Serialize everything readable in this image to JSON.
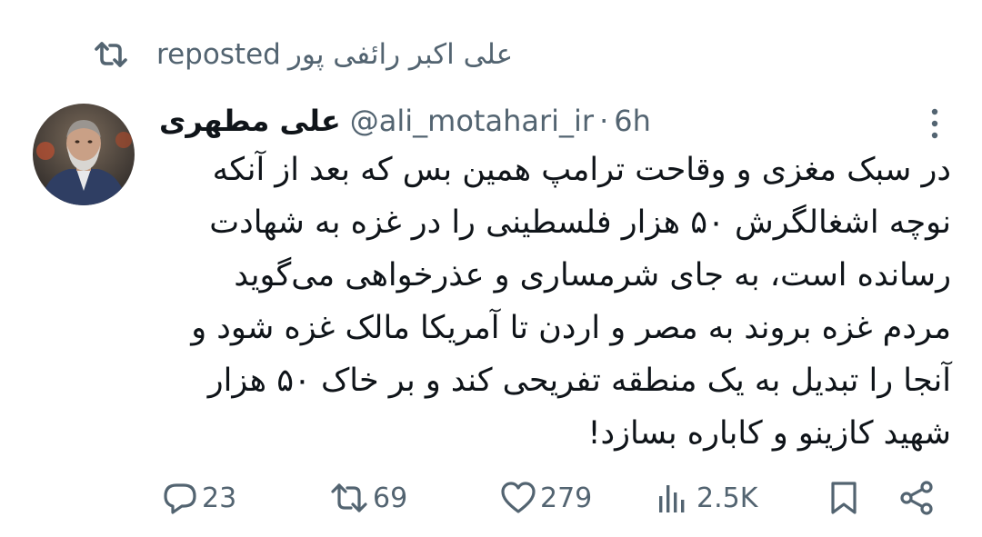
{
  "repost": {
    "icon": "repost-icon",
    "reposter_name": "علی اکبر رائفی پور",
    "label": "reposted"
  },
  "tweet": {
    "author": {
      "display_name": "علی مطهری",
      "handle": "@ali_motahari_ir",
      "separator": "·",
      "time": "6h",
      "avatar": "avatar-photo"
    },
    "text_lines": [
      "در سبک مغزی و وقاحت ترامپ همین بس که بعد از آنکه",
      "نوچه اشغالگرش ۵۰ هزار فلسطینی را در غزه به شهادت",
      "رسانده است، به جای شرمساری و عذرخواهی می‌گوید",
      "مردم غزه بروند به مصر و اردن تا آمریکا مالک غزه شود و",
      "آنجا را تبدیل به یک منطقه تفریحی کند و بر خاک ۵۰ هزار",
      "شهید کازینو و کاباره بسازد!"
    ]
  },
  "actions": {
    "reply": {
      "icon": "reply-icon",
      "count": "23"
    },
    "repost": {
      "icon": "repost-icon",
      "count": "69"
    },
    "like": {
      "icon": "heart-icon",
      "count": "279"
    },
    "views": {
      "icon": "views-icon",
      "count": "2.5K"
    },
    "bookmark": {
      "icon": "bookmark-icon"
    },
    "share": {
      "icon": "share-icon"
    }
  },
  "colors": {
    "text": "#0f1419",
    "secondary": "#536471",
    "background": "#ffffff"
  }
}
